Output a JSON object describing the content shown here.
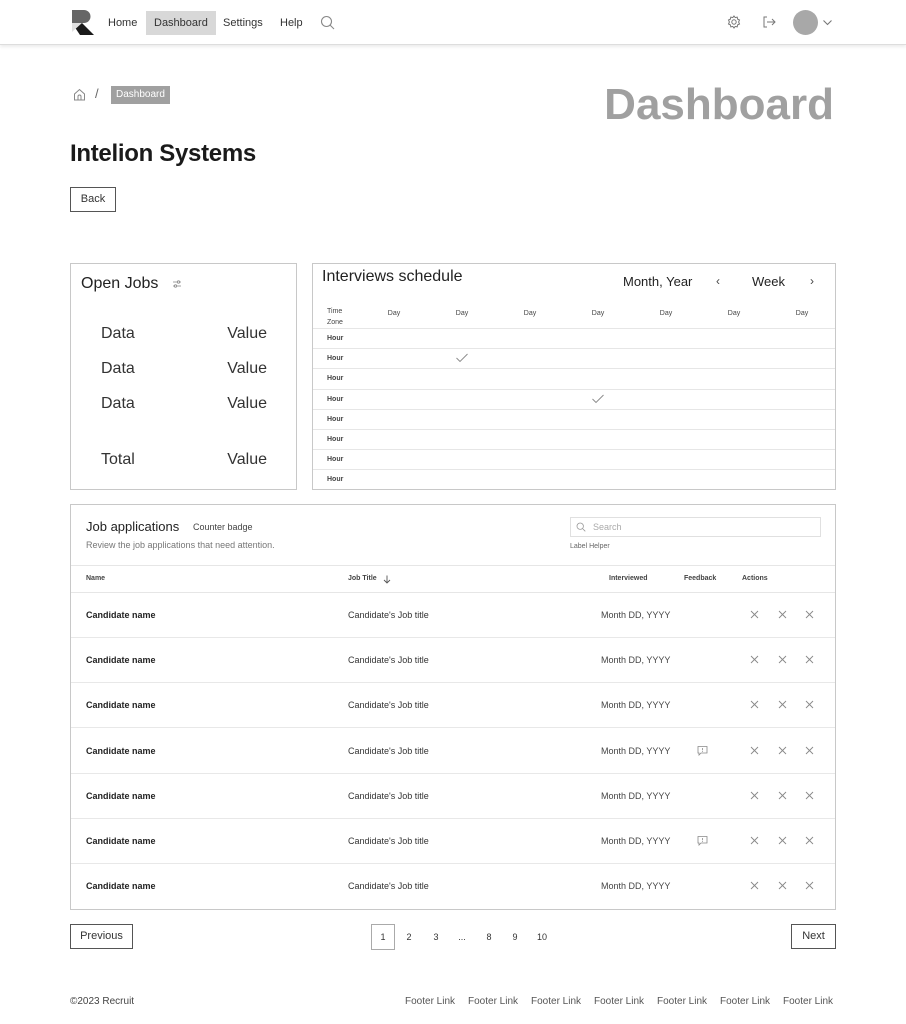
{
  "nav": {
    "items": [
      {
        "label": "Home",
        "active": false
      },
      {
        "label": "Dashboard",
        "active": true
      },
      {
        "label": "Settings",
        "active": false
      },
      {
        "label": "Help",
        "active": false
      }
    ],
    "icons": [
      "search-icon",
      "gear-icon",
      "logout-icon",
      "avatar",
      "chevron-down-icon"
    ]
  },
  "breadcrumb": {
    "separator": "/",
    "current": "Dashboard"
  },
  "page": {
    "title": "Dashboard",
    "company": "Intelion Systems",
    "back_label": "Back"
  },
  "open_jobs": {
    "title": "Open Jobs",
    "rows": [
      {
        "label": "Data",
        "value": "Value"
      },
      {
        "label": "Data",
        "value": "Value"
      },
      {
        "label": "Data",
        "value": "Value"
      }
    ],
    "total": {
      "label": "Total",
      "value": "Value"
    }
  },
  "schedule": {
    "title": "Interviews schedule",
    "month_year": "Month, Year",
    "prev": "‹",
    "week": "Week",
    "next": "›",
    "tz_label": [
      "Time",
      "Zone"
    ],
    "days": [
      "Day",
      "Day",
      "Day",
      "Day",
      "Day",
      "Day",
      "Day"
    ],
    "hours": [
      "Hour",
      "Hour",
      "Hour",
      "Hour",
      "Hour",
      "Hour",
      "Hour",
      "Hour"
    ],
    "checked": [
      {
        "hour_index": 1,
        "day_index": 1
      },
      {
        "hour_index": 3,
        "day_index": 3
      }
    ]
  },
  "job_applications": {
    "title": "Job applications",
    "badge": "Counter badge",
    "subtitle": "Review the job applications that need attention.",
    "search_placeholder": "Search",
    "label_helper": "Label Helper",
    "columns": {
      "name": "Name",
      "job_title": "Job Title",
      "interviewed": "Interviewed",
      "feedback": "Feedback",
      "actions": "Actions"
    },
    "rows": [
      {
        "name": "Candidate name",
        "job_title": "Candidate's Job title",
        "interviewed": "Month DD, YYYY",
        "feedback": false
      },
      {
        "name": "Candidate name",
        "job_title": "Candidate's Job title",
        "interviewed": "Month DD, YYYY",
        "feedback": false
      },
      {
        "name": "Candidate name",
        "job_title": "Candidate's Job title",
        "interviewed": "Month DD, YYYY",
        "feedback": false
      },
      {
        "name": "Candidate name",
        "job_title": "Candidate's Job title",
        "interviewed": "Month DD, YYYY",
        "feedback": true
      },
      {
        "name": "Candidate name",
        "job_title": "Candidate's Job title",
        "interviewed": "Month DD, YYYY",
        "feedback": false
      },
      {
        "name": "Candidate name",
        "job_title": "Candidate's Job title",
        "interviewed": "Month DD, YYYY",
        "feedback": true
      },
      {
        "name": "Candidate name",
        "job_title": "Candidate's Job title",
        "interviewed": "Month DD, YYYY",
        "feedback": false
      }
    ]
  },
  "pagination": {
    "previous": "Previous",
    "next": "Next",
    "pages": [
      "1",
      "2",
      "3",
      "...",
      "8",
      "9",
      "10"
    ],
    "current": "1"
  },
  "footer": {
    "copyright": "©2023 Recruit",
    "links": [
      "Footer Link",
      "Footer Link",
      "Footer Link",
      "Footer Link",
      "Footer Link",
      "Footer Link",
      "Footer Link"
    ]
  }
}
